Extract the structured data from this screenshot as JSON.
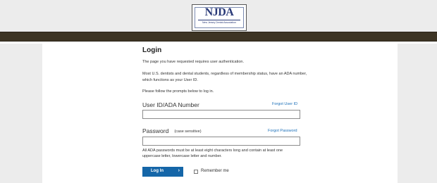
{
  "logo": {
    "text": "NJDA",
    "subtitle": "New Jersey Dental Association"
  },
  "login": {
    "title": "Login",
    "auth_message": "The page you have requested requires user authentication.",
    "ada_info": "Most U.S. dentists and dental students, regardless of membership status, have an ADA number, which functions as your User ID.",
    "prompt": "Please follow the prompts below to log in.",
    "user_id": {
      "label": "User ID/ADA Number",
      "forgot_link": "Forgot User ID",
      "value": ""
    },
    "password": {
      "label": "Password",
      "note": "(case sensitive)",
      "forgot_link": "Forgot Password",
      "value": ""
    },
    "password_rules": "All ADA passwords must be at least eight characters long and contain at least one uppercase letter, lowercase letter and number.",
    "login_button": "Log In",
    "login_arrow": "›",
    "remember_me": "Remember me"
  },
  "colors": {
    "header_bar": "#3d3424",
    "button": "#1566a8",
    "link": "#1b6fb8"
  }
}
